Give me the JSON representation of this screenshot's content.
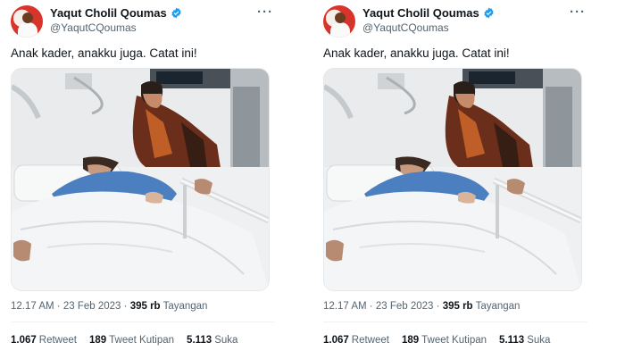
{
  "tweets": [
    {
      "author": {
        "name": "Yaqut Cholil Qoumas",
        "handle": "@YaqutCQoumas"
      },
      "text": "Anak kader, anakku juga. Catat ini!",
      "meta": {
        "time": "12.17 AM",
        "sep": "·",
        "date": "23 Feb 2023",
        "sep2": "·",
        "views": "395 rb",
        "views_label": "Tayangan"
      },
      "stats": {
        "retweets": "1.067",
        "retweets_label": "Retweet",
        "quotes": "189",
        "quotes_label": "Tweet Kutipan",
        "likes": "5.113",
        "likes_label": "Suka"
      }
    },
    {
      "author": {
        "name": "Yaqut Cholil Qoumas",
        "handle": "@YaqutCQoumas"
      },
      "text": "Anak kader, anakku juga. Catat ini!",
      "meta": {
        "time": "12.17 AM",
        "sep": "·",
        "date": "23 Feb 2023",
        "sep2": "·",
        "views": "395 rb",
        "views_label": "Tayangan"
      },
      "stats": {
        "retweets": "1.067",
        "retweets_label": "Retweet",
        "quotes": "189",
        "quotes_label": "Tweet Kutipan",
        "likes": "5.113",
        "likes_label": "Suka"
      }
    }
  ],
  "icons": {
    "verified": "verified-badge-icon",
    "more": "more-options-icon"
  },
  "colors": {
    "verified": "#1d9bf0",
    "secondary_text": "#536471",
    "primary_text": "#0f1419"
  }
}
